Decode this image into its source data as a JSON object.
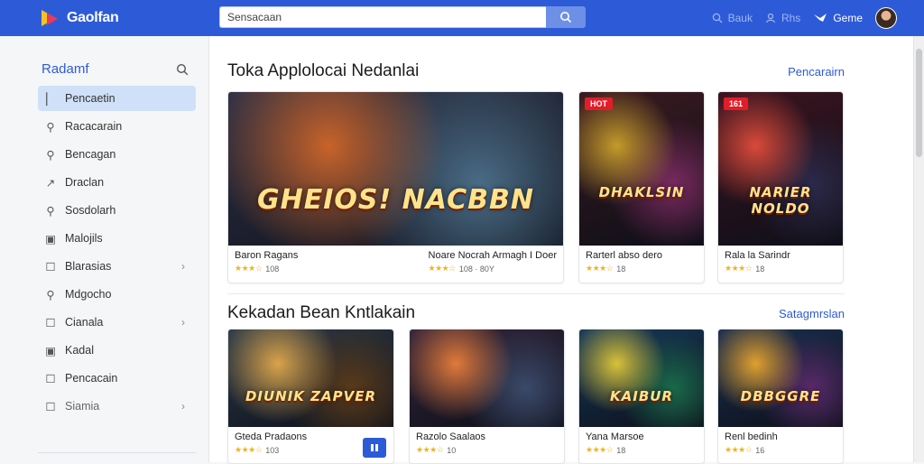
{
  "app": {
    "name": "Gaolfan"
  },
  "search": {
    "placeholder": "Sensacaan"
  },
  "top_links": [
    {
      "label": "Bauk",
      "icon": "search-icon"
    },
    {
      "label": "Rhs",
      "icon": "person-icon"
    },
    {
      "label": "Geme",
      "icon": "bird-icon"
    }
  ],
  "sidebar": {
    "title": "Radamf",
    "items": [
      {
        "label": "Pencaetin",
        "icon": "bookmark-icon"
      },
      {
        "label": "Racacarain",
        "icon": "search-icon"
      },
      {
        "label": "Bencagan",
        "icon": "search-icon"
      },
      {
        "label": "Draclan",
        "icon": "arrow-icon"
      },
      {
        "label": "Sosdolarh",
        "icon": "search-icon"
      },
      {
        "label": "Malojils",
        "icon": "image-icon"
      },
      {
        "label": "Blarasias",
        "icon": "doc-icon"
      },
      {
        "label": "Mdgocho",
        "icon": "search-icon"
      },
      {
        "label": "Cianala",
        "icon": "doc-icon"
      },
      {
        "label": "Kadal",
        "icon": "image-icon"
      },
      {
        "label": "Pencacain",
        "icon": "doc-icon"
      },
      {
        "label": "Siamia",
        "icon": "doc-icon"
      }
    ]
  },
  "sections": [
    {
      "title": "Toka Applolocai Nedanlai",
      "link": "Pencarairn",
      "cards": [
        {
          "name": "Baron Ragans",
          "rating": "108",
          "badge": "",
          "art": "GHEIOS! NACBBN",
          "colors": [
            "#2e3146",
            "#c8632a",
            "#4a6c86"
          ]
        },
        {
          "name": "Noare Nocrah Armagh I Doer",
          "rating": "108 · 80Y",
          "badge": "",
          "art": "",
          "colors": [
            "#1c2230",
            "#6c7a8e",
            "#c24a2a"
          ]
        },
        {
          "name": "Rarterl abso dero",
          "rating": "18",
          "badge": "HOT",
          "art": "DHAKLSIN",
          "colors": [
            "#3b1a20",
            "#c49a2a",
            "#7a2a60"
          ]
        },
        {
          "name": "Rala la Sarindr",
          "rating": "18",
          "badge": "161",
          "art": "NARIER NOLDO",
          "colors": [
            "#3b1420",
            "#d94a3a",
            "#2a2a4a"
          ]
        }
      ]
    },
    {
      "title": "Kekadan Bean Kntlakain",
      "link": "Satagmrslan",
      "cards": [
        {
          "name": "Gteda Pradaons",
          "rating": "103",
          "badge": "",
          "art": "DIUNIK ZAPVER",
          "colors": [
            "#2a3a4a",
            "#d9a34a",
            "#5a3a1a"
          ]
        },
        {
          "name": "Razolo Saalaos",
          "rating": "10",
          "badge": "",
          "art": "",
          "colors": [
            "#33243a",
            "#e07a3a",
            "#3a4a6a"
          ]
        },
        {
          "name": "Yana Marsoe",
          "rating": "18",
          "badge": "",
          "art": "KAIBUR",
          "colors": [
            "#163a5a",
            "#d8c23a",
            "#1a6a4a"
          ]
        },
        {
          "name": "Renl bedinh",
          "rating": "16",
          "badge": "",
          "art": "DBBGGRE",
          "colors": [
            "#1a3050",
            "#e0a030",
            "#5a2a6a"
          ]
        }
      ]
    }
  ]
}
